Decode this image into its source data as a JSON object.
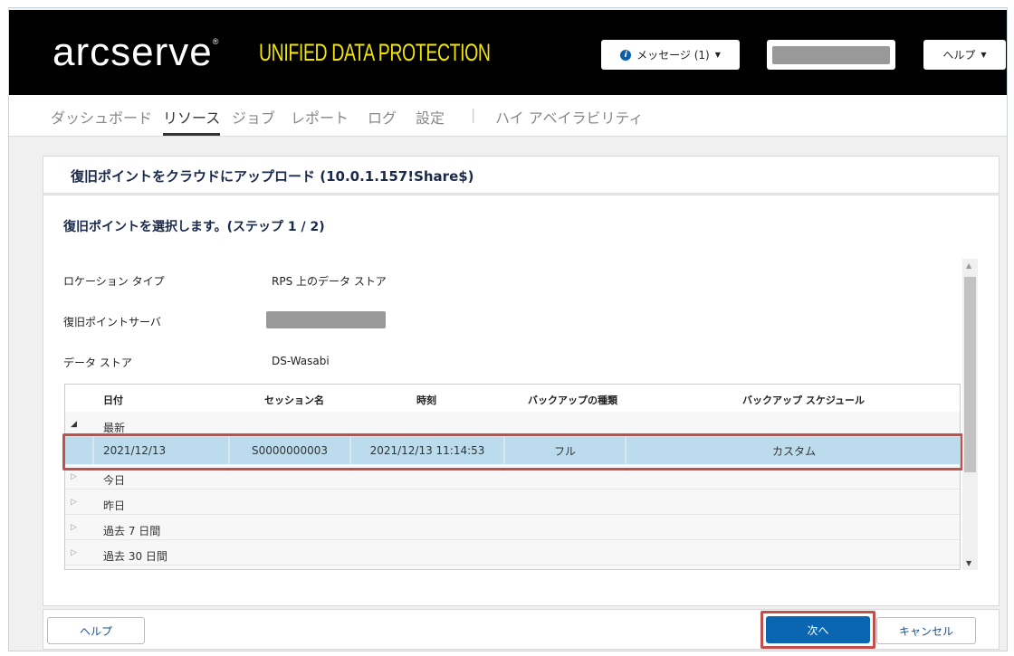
{
  "header": {
    "logo": "arcserve",
    "product": "UNIFIED DATA PROTECTION",
    "messages": "メッセージ (1)",
    "help": "ヘルプ"
  },
  "nav": [
    "ダッシュボード",
    "リソース",
    "ジョブ",
    "レポート",
    "ログ",
    "設定",
    "|",
    "ハイ アベイラビリティ"
  ],
  "dialog": {
    "title": "復旧ポイントをクラウドにアップロード (10.0.1.157!Share$)",
    "step": "復旧ポイントを選択します。(ステップ 1 / 2)"
  },
  "fields": {
    "location_label": "ロケーション タイプ",
    "location_value": "RPS 上のデータ ストア",
    "server_label": "復旧ポイントサーバ",
    "store_label": "データ ストア",
    "store_value": "DS-Wasabi"
  },
  "table": {
    "columns": [
      "日付",
      "セッション名",
      "時刻",
      "バックアップの種類",
      "バックアップ スケジュール"
    ],
    "groups": [
      "最新",
      "今日",
      "昨日",
      "過去 7 日間",
      "過去 30 日間"
    ],
    "selected_row": [
      "2021/12/13",
      "S0000000003",
      "2021/12/13 11:14:53",
      "フル",
      "カスタム"
    ]
  },
  "footer": {
    "help": "ヘルプ",
    "next": "次へ",
    "cancel": "キャンセル"
  }
}
